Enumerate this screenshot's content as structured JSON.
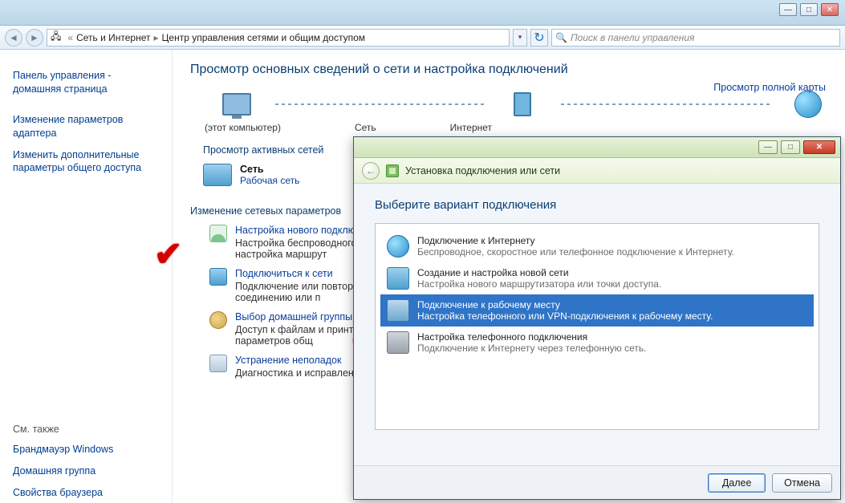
{
  "window_controls": {
    "min": "—",
    "max": "□",
    "close": "✕"
  },
  "breadcrumb": {
    "root": "Сеть и Интернет",
    "current": "Центр управления сетями и общим доступом"
  },
  "search_placeholder": "Поиск в панели управления",
  "sidebar": {
    "home": "Панель управления - домашняя страница",
    "links": [
      "Изменение параметров адаптера",
      "Изменить дополнительные параметры общего доступа"
    ],
    "seealso_title": "См. также",
    "seealso": [
      "Брандмауэр Windows",
      "Домашняя группа",
      "Свойства браузера"
    ]
  },
  "content": {
    "heading": "Просмотр основных сведений о сети и настройка подключений",
    "map_full": "Просмотр полной карты",
    "row_labels": {
      "computer": "(этот компьютер)",
      "network": "Сеть",
      "internet": "Интернет"
    },
    "active_title": "Просмотр активных сетей",
    "network": {
      "name": "Сеть",
      "type": "Рабочая сеть"
    },
    "params_title": "Изменение сетевых параметров",
    "options": [
      {
        "title": "Настройка нового подключ",
        "desc": "Настройка беспроводного, или же настройка маршрут"
      },
      {
        "title": "Подключиться к сети",
        "desc": "Подключение или повторн сетевому соединению или п"
      },
      {
        "title": "Выбор домашней группы и",
        "desc": "Доступ к файлам и принтер изменение параметров общ"
      },
      {
        "title": "Устранение неполадок",
        "desc": "Диагностика и исправление"
      }
    ]
  },
  "dialog": {
    "header_text": "Установка подключения или сети",
    "title": "Выберите вариант подключения",
    "items": [
      {
        "t": "Подключение к Интернету",
        "d": "Беспроводное, скоростное или телефонное подключение к Интернету."
      },
      {
        "t": "Создание и настройка новой сети",
        "d": "Настройка нового маршрутизатора или точки доступа."
      },
      {
        "t": "Подключение к рабочему месту",
        "d": "Настройка телефонного или VPN-подключения к рабочему месту."
      },
      {
        "t": "Настройка телефонного подключения",
        "d": "Подключение к Интернету через телефонную сеть."
      }
    ],
    "selected_index": 2,
    "buttons": {
      "next": "Далее",
      "cancel": "Отмена"
    }
  }
}
